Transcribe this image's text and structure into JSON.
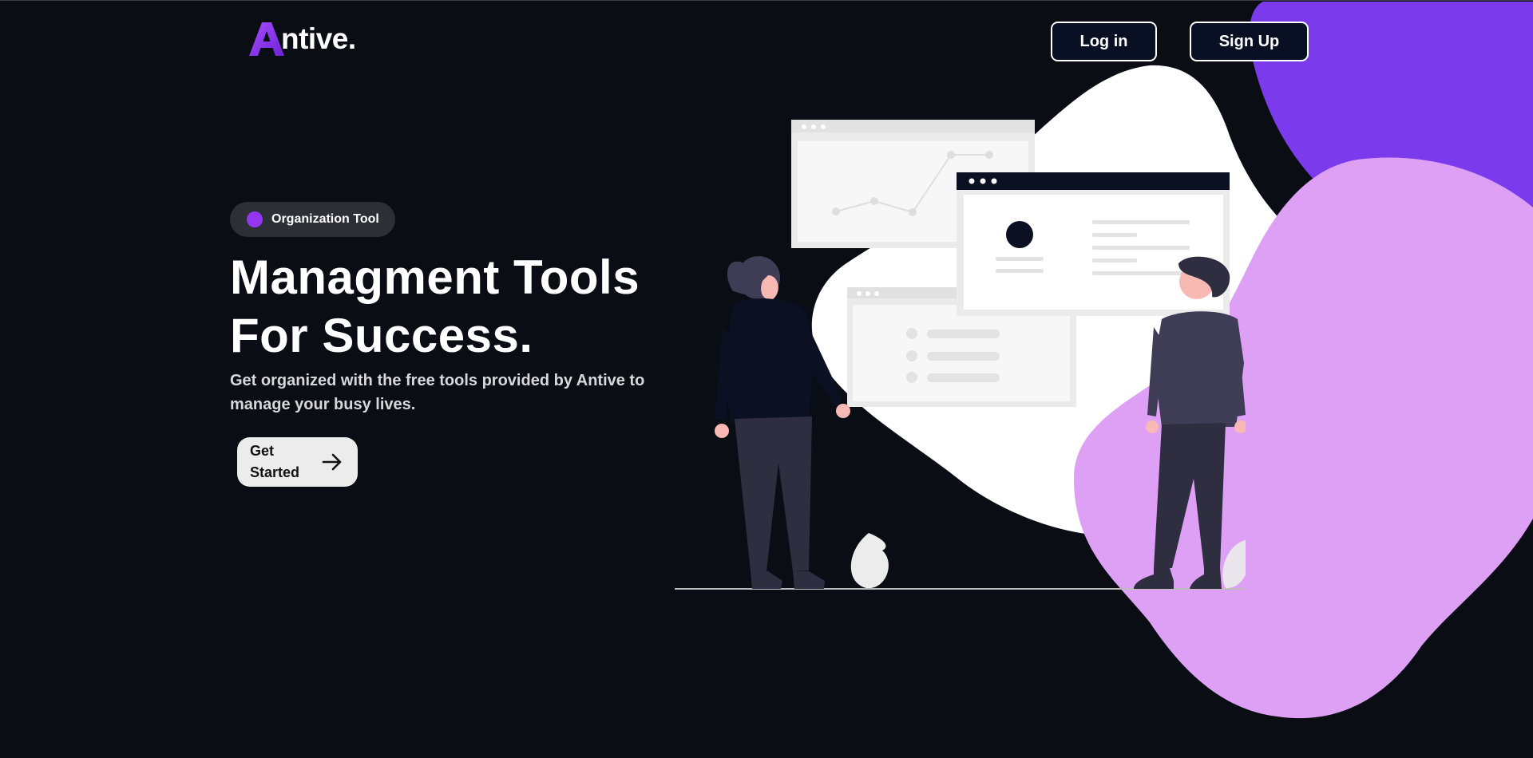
{
  "brand": {
    "name": "ntive.",
    "mark_icon": "letter-a-logo-icon",
    "accent": "#8b2bf0"
  },
  "nav": {
    "login_label": "Log in",
    "signup_label": "Sign Up"
  },
  "hero": {
    "badge_label": "Organization Tool",
    "title_line1": "Managment Tools",
    "title_line2": "For Success.",
    "subtitle_line1": "Get organized with the free tools provided by Antive to",
    "subtitle_line2": "manage your busy lives.",
    "cta_line1": "Get",
    "cta_line2": "Started",
    "cta_icon": "arrow-right-icon"
  },
  "colors": {
    "background": "#0a0d14",
    "blob_dark_purple": "#7c3aed",
    "blob_light_purple": "#dea0f4",
    "blob_white": "#ffffff",
    "badge_bg": "#2d2f37",
    "badge_dot": "#9436f0",
    "cta_bg": "#ececec"
  }
}
